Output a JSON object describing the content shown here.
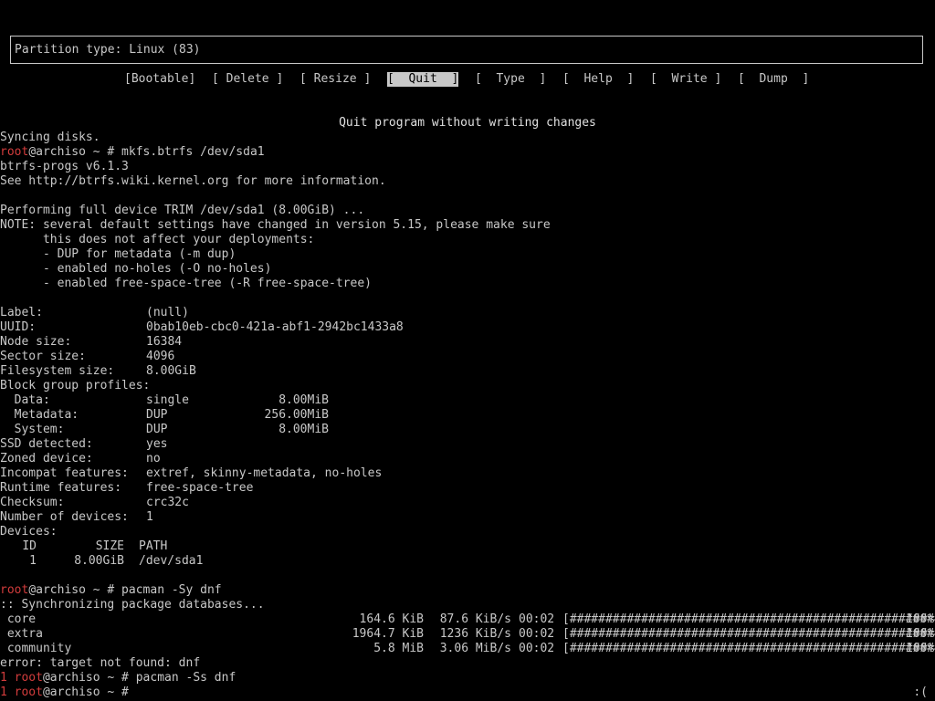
{
  "cfdisk": {
    "partition_type": "Partition type: Linux (83)",
    "menu": [
      {
        "label": "[Bootable]",
        "selected": false
      },
      {
        "label": "[ Delete ]",
        "selected": false
      },
      {
        "label": "[ Resize ]",
        "selected": false
      },
      {
        "label": "[  Quit  ]",
        "selected": true
      },
      {
        "label": "[  Type  ]",
        "selected": false
      },
      {
        "label": "[  Help  ]",
        "selected": false
      },
      {
        "label": "[  Write ]",
        "selected": false
      },
      {
        "label": "[  Dump  ]",
        "selected": false
      }
    ],
    "hint": "Quit program without writing changes"
  },
  "shell": {
    "syncing": "Syncing disks.",
    "prompt1_user": "root",
    "prompt1_rest": "@archiso ~ # mkfs.btrfs /dev/sda1",
    "btrfs_version": "btrfs-progs v6.1.3",
    "see_info": "See http://btrfs.wiki.kernel.org for more information.",
    "trim": "Performing full device TRIM /dev/sda1 (8.00GiB) ...",
    "note": [
      "NOTE: several default settings have changed in version 5.15, please make sure",
      "      this does not affect your deployments:",
      "      - DUP for metadata (-m dup)",
      "      - enabled no-holes (-O no-holes)",
      "      - enabled free-space-tree (-R free-space-tree)"
    ],
    "fs_info": [
      {
        "key": "Label:",
        "value": "(null)"
      },
      {
        "key": "UUID:",
        "value": "0bab10eb-cbc0-421a-abf1-2942bc1433a8"
      },
      {
        "key": "Node size:",
        "value": "16384"
      },
      {
        "key": "Sector size:",
        "value": "4096"
      },
      {
        "key": "Filesystem size:",
        "value": "8.00GiB"
      }
    ],
    "block_group_header": "Block group profiles:",
    "block_groups": [
      {
        "name": "  Data:",
        "profile": "single",
        "size": "8.00MiB"
      },
      {
        "name": "  Metadata:",
        "profile": "DUP",
        "size": "256.00MiB"
      },
      {
        "name": "  System:",
        "profile": "DUP",
        "size": "8.00MiB"
      }
    ],
    "fs_info2": [
      {
        "key": "SSD detected:",
        "value": "yes"
      },
      {
        "key": "Zoned device:",
        "value": "no"
      },
      {
        "key": "Incompat features:",
        "value": "extref, skinny-metadata, no-holes"
      },
      {
        "key": "Runtime features:",
        "value": "free-space-tree"
      },
      {
        "key": "Checksum:",
        "value": "crc32c"
      },
      {
        "key": "Number of devices:",
        "value": "1"
      }
    ],
    "devices_header": "Devices:",
    "devices_cols": {
      "id": "ID",
      "size": "SIZE",
      "path": "PATH"
    },
    "devices_row": {
      "id": "1",
      "size": "8.00GiB",
      "path": "/dev/sda1"
    },
    "prompt2_user": "root",
    "prompt2_rest": "@archiso ~ # pacman -Sy dnf",
    "sync_msg": ":: Synchronizing package databases...",
    "repos": [
      {
        "name": " core",
        "size": "164.6 KiB",
        "speed": "87.6 KiB/s",
        "time": "00:02",
        "bar": "[######################################################]",
        "pct": "100%"
      },
      {
        "name": " extra",
        "size": "1964.7 KiB",
        "speed": "1236 KiB/s",
        "time": "00:02",
        "bar": "[######################################################]",
        "pct": "100%"
      },
      {
        "name": " community",
        "size": "5.8 MiB",
        "speed": "3.06 MiB/s",
        "time": "00:02",
        "bar": "[######################################################]",
        "pct": "100%"
      }
    ],
    "error": "error: target not found: dnf",
    "prompt3_code": "1 ",
    "prompt3_user": "root",
    "prompt3_rest": "@archiso ~ # pacman -Ss dnf",
    "prompt4_code": "1 ",
    "prompt4_user": "root",
    "prompt4_rest": "@archiso ~ # ",
    "status_corner": ":("
  },
  "colors": {
    "background": "#000000",
    "foreground": "#c8c8c8",
    "prompt_user": "#d23c3c"
  }
}
